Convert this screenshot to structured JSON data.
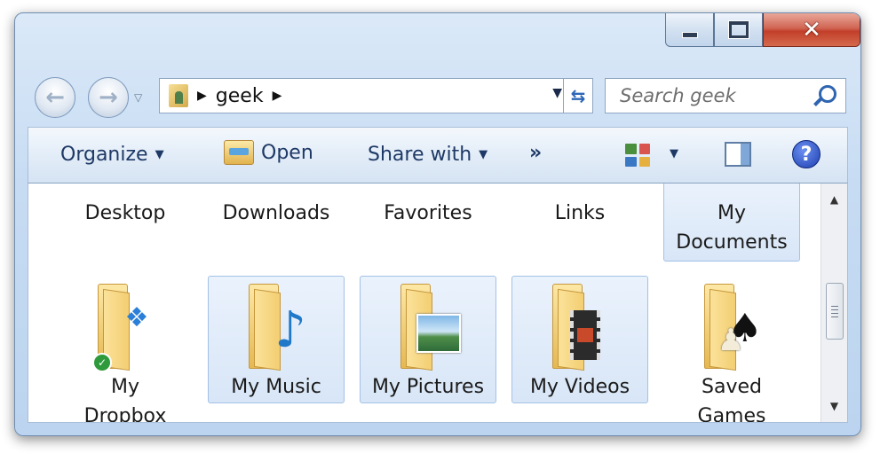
{
  "address_bar": {
    "breadcrumbs": [
      "geek"
    ]
  },
  "search": {
    "placeholder": "Search geek"
  },
  "command_bar": {
    "organize_label": "Organize",
    "open_label": "Open",
    "share_label": "Share with",
    "more_label": "»"
  },
  "items_top_row": [
    {
      "label": "Desktop"
    },
    {
      "label": "Downloads"
    },
    {
      "label": "Favorites"
    },
    {
      "label": "Links"
    },
    {
      "label_line1": "My",
      "label_line2": "Documents",
      "selected": true
    }
  ],
  "items_bottom_row": [
    {
      "label_line1": "My",
      "label_line2": "Dropbox",
      "badge_icon": "dropbox-icon"
    },
    {
      "label": "My Music",
      "badge_icon": "music-note-icon",
      "selected": true
    },
    {
      "label": "My Pictures",
      "badge_icon": "picture-icon",
      "selected": true
    },
    {
      "label": "My Videos",
      "badge_icon": "film-strip-icon",
      "selected": true
    },
    {
      "label_line1": "Saved",
      "label_line2": "Games",
      "badge_icon": "chess-pieces-icon"
    }
  ],
  "colors": {
    "selection_bg": "#d8e6f7",
    "selection_border": "#a3c1e6",
    "command_text": "#1e3966",
    "close_button": "#c23f2a"
  }
}
